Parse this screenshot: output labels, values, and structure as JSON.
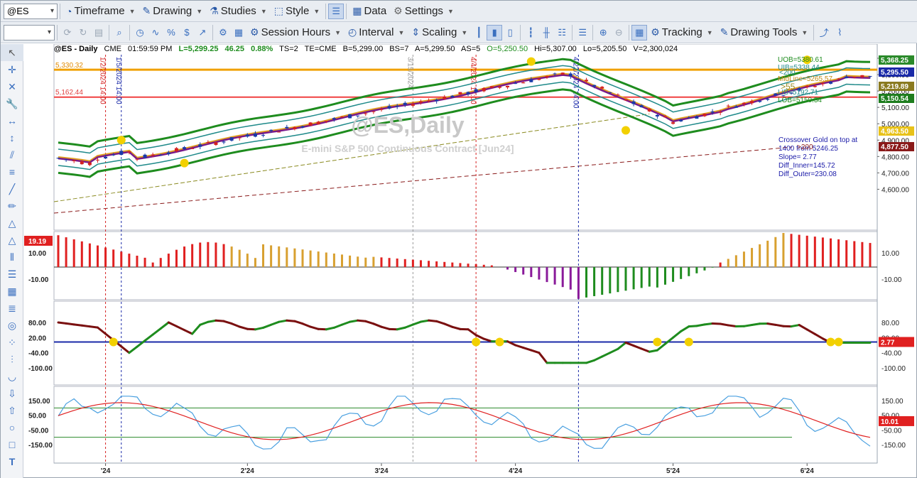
{
  "toolbar1": {
    "symbol": "@ES",
    "timeframe": "Timeframe",
    "drawing": "Drawing",
    "studies": "Studies",
    "style": "Style",
    "data": "Data",
    "settings": "Settings"
  },
  "toolbar2": {
    "session_hours": "Session Hours",
    "interval": "Interval",
    "scaling": "Scaling",
    "tracking": "Tracking",
    "drawing_tools": "Drawing Tools"
  },
  "header": {
    "symbol": "@ES - Daily",
    "exchange": "CME",
    "time": "01:59:59 PM",
    "last": "L=5,299.25",
    "change": "46.25",
    "pct": "0.88%",
    "ts": "TS=2",
    "te": "TE=CME",
    "bid": "B=5,299.00",
    "bs": "BS=7",
    "ask": "A=5,299.50",
    "as": "AS=5",
    "open": "O=5,250.50",
    "high": "Hi=5,307.00",
    "low": "Lo=5,205.50",
    "vol": "V=2,300,024"
  },
  "watermark": {
    "title": "@ES,Daily",
    "subtitle": "E-mini S&P 500 Continuous Contract [Jun24]"
  },
  "levels": {
    "orange_line": "5,330.32",
    "red_line": "5,162.44"
  },
  "bands": {
    "uob": "UOB=5380.61",
    "uib": "UIB=5338.44",
    "mid": "MidLine=5265.57",
    "lib": "LIB=5192.71",
    "lob": "LOB=5150.54",
    "gt55": ">55",
    "overlap": "<200"
  },
  "note": {
    "line1": "Crossover Gold on top at",
    "line2": "1400 from 5246.25",
    "line3": "Slope= 2.77",
    "line4": "Diff_Inner=145.72",
    "line5": "Diff_Outer=230.08",
    "badge": ">200"
  },
  "price_axis": [
    "5,400.00",
    "5,300.00",
    "5,200.00",
    "5,100.00",
    "5,000.00",
    "4,900.00",
    "4,800.00",
    "4,700.00",
    "4,600.00"
  ],
  "right_labels": [
    {
      "text": "5,368.25",
      "color": "#2a8a2a"
    },
    {
      "text": "5,295.50",
      "color": "#1a2aa8"
    },
    {
      "text": "5,219.89",
      "color": "#8a7a20"
    },
    {
      "text": "5,150.54",
      "color": "#1e7d1e"
    },
    {
      "text": "4,963.50",
      "color": "#e8c21a"
    },
    {
      "text": "4,877.50",
      "color": "#8a1a1a"
    }
  ],
  "hist_axis": [
    "10.00",
    "-10.00"
  ],
  "hist_value": "19.19",
  "osc1_axis": [
    "80.00",
    "20.00",
    "-40.00",
    "-100.00"
  ],
  "osc1_value": "2.77",
  "osc2_axis": [
    "150.00",
    "50.00",
    "-50.00",
    "-150.00"
  ],
  "osc2_value": "10.01",
  "xaxis": [
    "'24",
    "2'24",
    "3'24",
    "4'24",
    "5'24",
    "6'24"
  ],
  "vlines": [
    {
      "label": "1/2/2024 14:00",
      "color": "#d42020"
    },
    {
      "label": "1/5/2024 14:00",
      "color": "#1a2aa8"
    },
    {
      "label": "3/15/2024",
      "color": "#999999"
    },
    {
      "label": "4/4/2024 14:00",
      "color": "#d42020"
    },
    {
      "label": "4/22/2024 14:00",
      "color": "#1a2aa8"
    }
  ],
  "colors": {
    "green": "#1e8c1e",
    "teal": "#1f8a8a",
    "purple": "#7a1a8a",
    "gold": "#e0a020",
    "red": "#e02020",
    "blue": "#1a2aa8",
    "maroon": "#7a1010",
    "yellow": "#f2d000"
  }
}
